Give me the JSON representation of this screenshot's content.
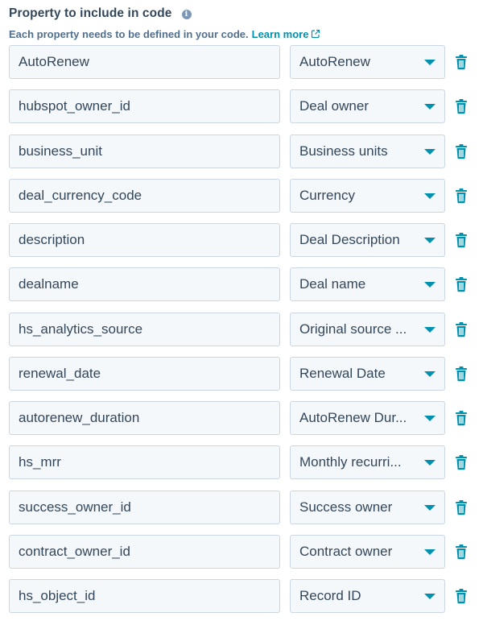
{
  "header": {
    "title": "Property to include in code",
    "info_icon": "info-icon",
    "subtitle": "Each property needs to be defined in your code.",
    "learn_more": "Learn more",
    "learn_more_icon": "external-link-icon"
  },
  "colors": {
    "text": "#33475b",
    "link": "#0091ae",
    "field_bg": "#f5f8fa",
    "field_border": "#cbd6e2"
  },
  "rows": [
    {
      "code": "AutoRenew",
      "property": "AutoRenew"
    },
    {
      "code": "hubspot_owner_id",
      "property": "Deal owner"
    },
    {
      "code": "business_unit",
      "property": "Business units"
    },
    {
      "code": "deal_currency_code",
      "property": "Currency"
    },
    {
      "code": "description",
      "property": "Deal Description"
    },
    {
      "code": "dealname",
      "property": "Deal name"
    },
    {
      "code": "hs_analytics_source",
      "property": "Original source ..."
    },
    {
      "code": "renewal_date",
      "property": "Renewal Date"
    },
    {
      "code": "autorenew_duration",
      "property": "AutoRenew Dur..."
    },
    {
      "code": "hs_mrr",
      "property": "Monthly recurri..."
    },
    {
      "code": "success_owner_id",
      "property": "Success owner"
    },
    {
      "code": "contract_owner_id",
      "property": "Contract owner"
    },
    {
      "code": "hs_object_id",
      "property": "Record ID"
    }
  ],
  "row_icons": {
    "dropdown": "caret-down-icon",
    "delete": "trash-icon"
  }
}
